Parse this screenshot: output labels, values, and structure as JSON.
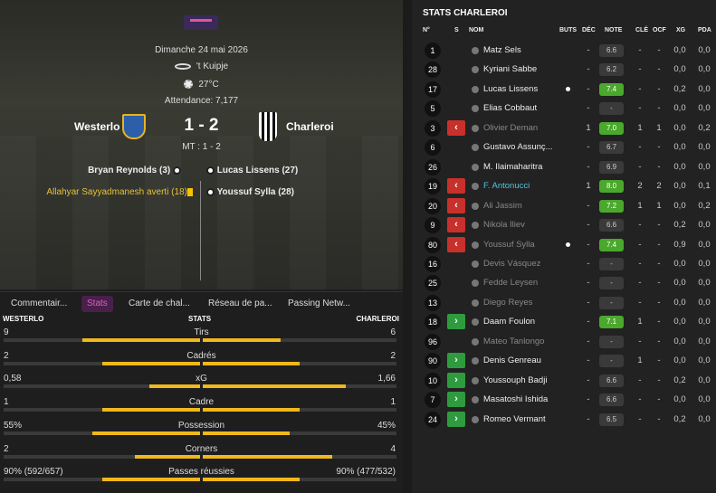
{
  "match": {
    "date": "Dimanche 24 mai 2026",
    "stadium": "'t Kuipje",
    "weather": "27°C",
    "attendance": "Attendance: 7,177",
    "home": "Westerlo",
    "away": "Charleroi",
    "score": "1 - 2",
    "halftime": "MT : 1 - 2"
  },
  "events": {
    "home_goal": "Bryan Reynolds (3)",
    "home_card": "Allahyar Sayyadmanesh averti (18)",
    "away_goal1": "Lucas Lissens (27)",
    "away_goal2": "Youssuf Sylla (28)"
  },
  "tabs": [
    "Commentair...",
    "Stats",
    "Carte de chal...",
    "Réseau de pa...",
    "Passing Netw..."
  ],
  "stats_header": {
    "home": "WESTERLO",
    "mid": "STATS",
    "away": "CHARLEROI"
  },
  "stats": [
    {
      "label": "Tirs",
      "home": "9",
      "away": "6",
      "home_frac": 0.6,
      "away_frac": 0.4
    },
    {
      "label": "Cadrés",
      "home": "2",
      "away": "2",
      "home_frac": 0.5,
      "away_frac": 0.5
    },
    {
      "label": "xG",
      "home": "0,58",
      "away": "1,66",
      "home_frac": 0.26,
      "away_frac": 0.74
    },
    {
      "label": "Cadre",
      "home": "1",
      "away": "1",
      "home_frac": 0.5,
      "away_frac": 0.5
    },
    {
      "label": "Possession",
      "home": "55%",
      "away": "45%",
      "home_frac": 0.55,
      "away_frac": 0.45
    },
    {
      "label": "Corners",
      "home": "2",
      "away": "4",
      "home_frac": 0.33,
      "away_frac": 0.67
    },
    {
      "label": "Passes réussies",
      "home": "90% (592/657)",
      "away": "90% (477/532)",
      "home_frac": 0.5,
      "away_frac": 0.5
    }
  ],
  "right": {
    "title": "STATS CHARLEROI",
    "cols": [
      "N°",
      "S",
      "NOM",
      "BUTS",
      "DÉC",
      "NOTE",
      "CLÉ",
      "OCF",
      "XG",
      "PDA"
    ]
  },
  "players": [
    {
      "num": "1",
      "sub": "",
      "name": "Matz Sels",
      "goal": false,
      "dec": "-",
      "note": "6.6",
      "good": false,
      "cle": "-",
      "ocf": "-",
      "xg": "0,0",
      "pda": "0,0",
      "style": ""
    },
    {
      "num": "28",
      "sub": "",
      "name": "Kyriani Sabbe",
      "goal": false,
      "dec": "-",
      "note": "6.2",
      "good": false,
      "cle": "-",
      "ocf": "-",
      "xg": "0,0",
      "pda": "0,0",
      "style": ""
    },
    {
      "num": "17",
      "sub": "",
      "name": "Lucas Lissens",
      "goal": true,
      "dec": "-",
      "note": "7.4",
      "good": true,
      "cle": "-",
      "ocf": "-",
      "xg": "0,2",
      "pda": "0,0",
      "style": ""
    },
    {
      "num": "5",
      "sub": "",
      "name": "Elias Cobbaut",
      "goal": false,
      "dec": "-",
      "note": "-",
      "good": false,
      "cle": "-",
      "ocf": "-",
      "xg": "0,0",
      "pda": "0,0",
      "style": ""
    },
    {
      "num": "3",
      "sub": "out",
      "name": "Olivier Deman",
      "goal": false,
      "dec": "1",
      "note": "7.0",
      "good": true,
      "cle": "1",
      "ocf": "1",
      "xg": "0,0",
      "pda": "0,2",
      "style": "dim"
    },
    {
      "num": "6",
      "sub": "",
      "name": "Gustavo Assunç...",
      "goal": false,
      "dec": "-",
      "note": "6.7",
      "good": false,
      "cle": "-",
      "ocf": "-",
      "xg": "0,0",
      "pda": "0,0",
      "style": ""
    },
    {
      "num": "26",
      "sub": "",
      "name": "M. Ilaimaharitra",
      "goal": false,
      "dec": "-",
      "note": "6.9",
      "good": false,
      "cle": "-",
      "ocf": "-",
      "xg": "0,0",
      "pda": "0,0",
      "style": ""
    },
    {
      "num": "19",
      "sub": "out",
      "name": "F. Antonucci",
      "goal": false,
      "dec": "1",
      "note": "8.0",
      "good": true,
      "cle": "2",
      "ocf": "2",
      "xg": "0,0",
      "pda": "0,1",
      "style": "hl"
    },
    {
      "num": "20",
      "sub": "out",
      "name": "Ali Jassim",
      "goal": false,
      "dec": "-",
      "note": "7.2",
      "good": true,
      "cle": "1",
      "ocf": "1",
      "xg": "0,0",
      "pda": "0,2",
      "style": "dim"
    },
    {
      "num": "9",
      "sub": "out",
      "name": "Nikola Iliev",
      "goal": false,
      "dec": "-",
      "note": "6.6",
      "good": false,
      "cle": "-",
      "ocf": "-",
      "xg": "0,2",
      "pda": "0,0",
      "style": "dim"
    },
    {
      "num": "80",
      "sub": "out",
      "name": "Youssuf Sylla",
      "goal": true,
      "dec": "-",
      "note": "7.4",
      "good": true,
      "cle": "-",
      "ocf": "-",
      "xg": "0,9",
      "pda": "0,0",
      "style": "dim"
    },
    {
      "num": "16",
      "sub": "",
      "name": "Devis Vásquez",
      "goal": false,
      "dec": "-",
      "note": "-",
      "good": false,
      "cle": "-",
      "ocf": "-",
      "xg": "0,0",
      "pda": "0,0",
      "style": "dim"
    },
    {
      "num": "25",
      "sub": "",
      "name": "Fedde Leysen",
      "goal": false,
      "dec": "-",
      "note": "-",
      "good": false,
      "cle": "-",
      "ocf": "-",
      "xg": "0,0",
      "pda": "0,0",
      "style": "dim"
    },
    {
      "num": "13",
      "sub": "",
      "name": "Diego Reyes",
      "goal": false,
      "dec": "-",
      "note": "-",
      "good": false,
      "cle": "-",
      "ocf": "-",
      "xg": "0,0",
      "pda": "0,0",
      "style": "dim"
    },
    {
      "num": "18",
      "sub": "in",
      "name": "Daam Foulon",
      "goal": false,
      "dec": "-",
      "note": "7.1",
      "good": true,
      "cle": "1",
      "ocf": "-",
      "xg": "0,0",
      "pda": "0,0",
      "style": ""
    },
    {
      "num": "96",
      "sub": "",
      "name": "Mateo Tanlongo",
      "goal": false,
      "dec": "-",
      "note": "-",
      "good": false,
      "cle": "-",
      "ocf": "-",
      "xg": "0,0",
      "pda": "0,0",
      "style": "dim"
    },
    {
      "num": "90",
      "sub": "in",
      "name": "Denis Genreau",
      "goal": false,
      "dec": "-",
      "note": "-",
      "good": false,
      "cle": "1",
      "ocf": "-",
      "xg": "0,0",
      "pda": "0,0",
      "style": ""
    },
    {
      "num": "10",
      "sub": "in",
      "name": "Youssouph Badji",
      "goal": false,
      "dec": "-",
      "note": "6.6",
      "good": false,
      "cle": "-",
      "ocf": "-",
      "xg": "0,2",
      "pda": "0,0",
      "style": ""
    },
    {
      "num": "7",
      "sub": "in",
      "name": "Masatoshi Ishida",
      "goal": false,
      "dec": "-",
      "note": "6.6",
      "good": false,
      "cle": "-",
      "ocf": "-",
      "xg": "0,0",
      "pda": "0,0",
      "style": ""
    },
    {
      "num": "24",
      "sub": "in",
      "name": "Romeo Vermant",
      "goal": false,
      "dec": "-",
      "note": "6.5",
      "good": false,
      "cle": "-",
      "ocf": "-",
      "xg": "0,2",
      "pda": "0,0",
      "style": ""
    }
  ]
}
